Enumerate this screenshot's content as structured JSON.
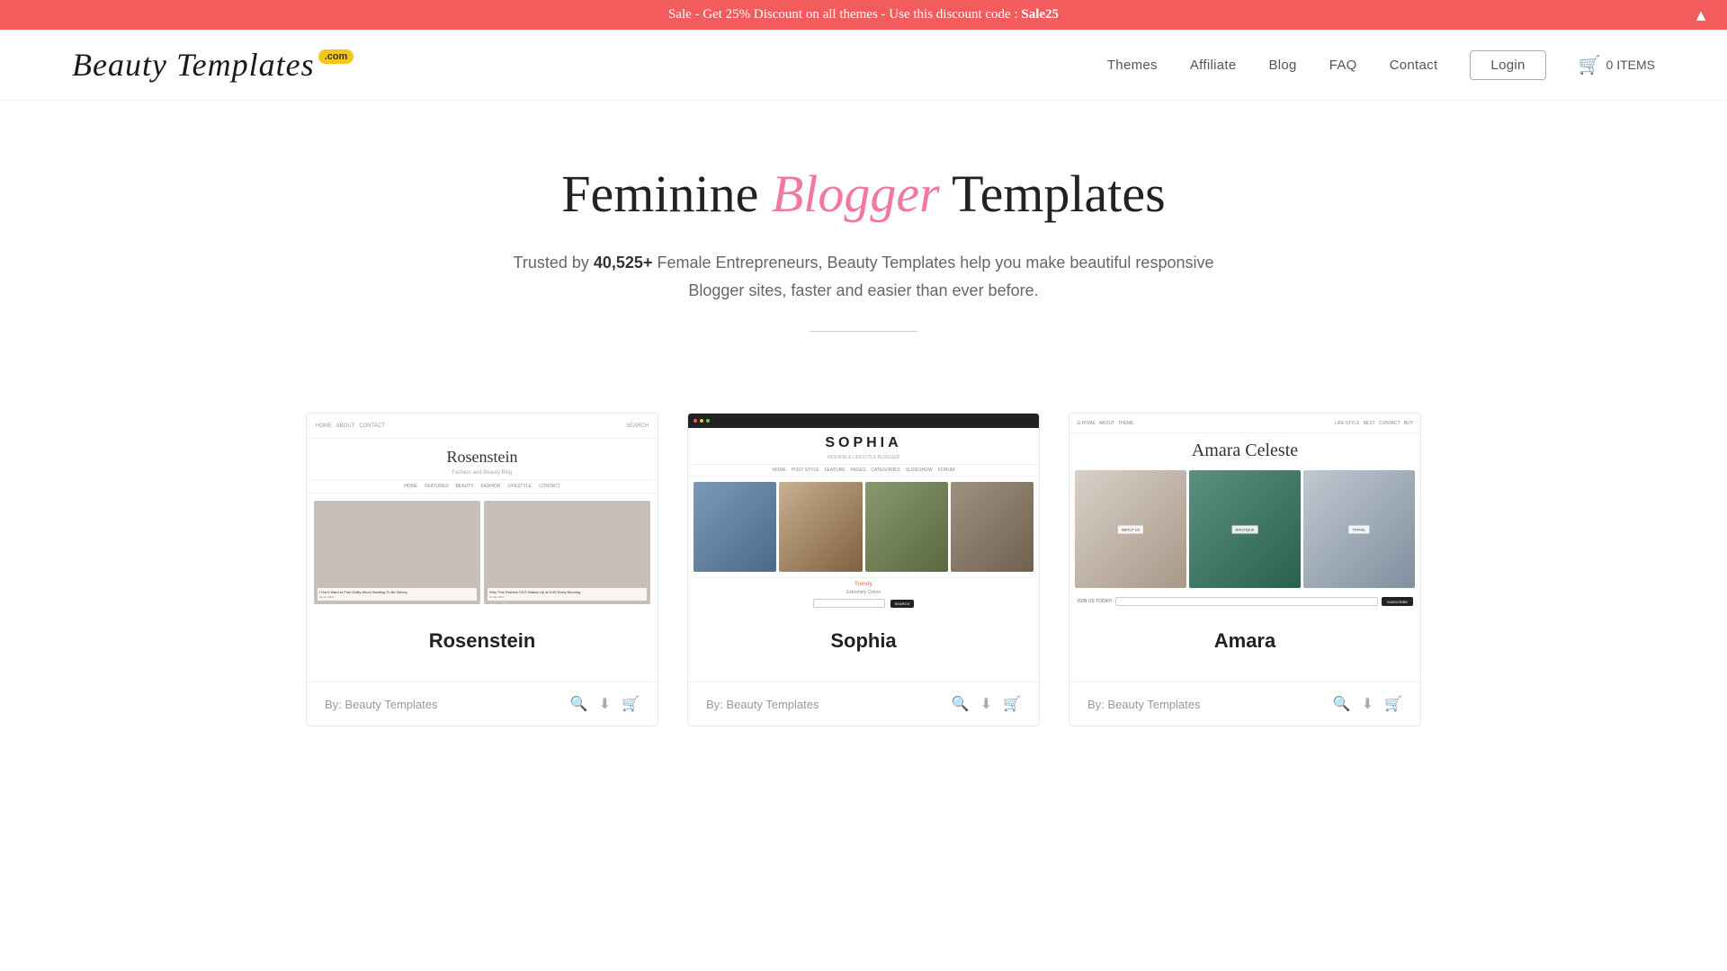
{
  "announcement": {
    "text": "Sale - Get 25% Discount on all themes - Use this discount code : ",
    "code": "Sale25",
    "close_label": "▲"
  },
  "header": {
    "logo_text": "Beauty Templates",
    "logo_badge": ".com",
    "nav": [
      {
        "label": "Themes",
        "href": "#themes"
      },
      {
        "label": "Affiliate",
        "href": "#affiliate"
      },
      {
        "label": "Blog",
        "href": "#blog"
      },
      {
        "label": "FAQ",
        "href": "#faq"
      },
      {
        "label": "Contact",
        "href": "#contact"
      }
    ],
    "login_label": "Login",
    "cart_label": "0 ITEMS"
  },
  "hero": {
    "title_part1": "Feminine ",
    "title_highlight": "Blogger",
    "title_part2": " Templates",
    "subtitle_before": "Trusted by ",
    "subtitle_count": "40,525+",
    "subtitle_after": " Female Entrepreneurs, Beauty Templates help you make beautiful responsive Blogger sites, faster and easier than ever before."
  },
  "cards": [
    {
      "name": "Rosenstein",
      "author": "By: Beauty Templates",
      "type": "rosenstein"
    },
    {
      "name": "Sophia",
      "author": "By: Beauty Templates",
      "type": "sophia"
    },
    {
      "name": "Amara",
      "author": "By: Beauty Templates",
      "type": "amara"
    }
  ],
  "card_actions": {
    "search_icon": "🔍",
    "download_icon": "⬇",
    "cart_icon": "🛒"
  },
  "colors": {
    "accent": "#f25c5c",
    "highlight_pink": "#f2789c",
    "logo_badge_bg": "#f5c518"
  }
}
